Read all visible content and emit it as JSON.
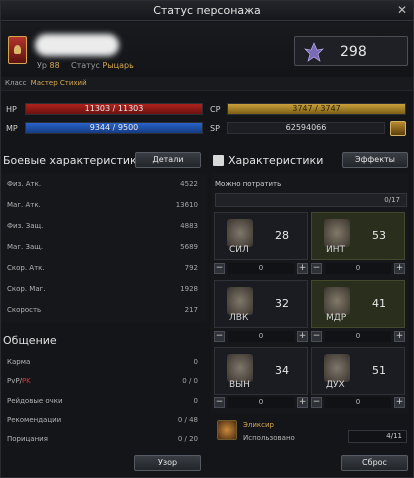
{
  "window": {
    "title": "Статус персонажа"
  },
  "character": {
    "level_label": "Ур",
    "level": "88",
    "status_label": "Статус",
    "status": "Рыцарь",
    "points": "298",
    "class_label": "Класс",
    "class_name": "Мастер Стихий"
  },
  "bars": {
    "hp_label": "HP",
    "hp": "11303 / 11303",
    "mp_label": "MP",
    "mp": "9344 / 9500",
    "cp_label": "CP",
    "cp": "3747 / 3747",
    "sp_label": "SP",
    "sp": "62594066"
  },
  "combat": {
    "title": "Боевые характеристики",
    "details_button": "Детали",
    "rows": [
      {
        "label": "Физ. Атк.",
        "value": "4522"
      },
      {
        "label": "Маг. Атк.",
        "value": "13610"
      },
      {
        "label": "Физ. Защ.",
        "value": "4883"
      },
      {
        "label": "Маг. Защ.",
        "value": "5689"
      },
      {
        "label": "Скор. Атк.",
        "value": "792"
      },
      {
        "label": "Скор. Маг.",
        "value": "1928"
      },
      {
        "label": "Скорость",
        "value": "217"
      }
    ]
  },
  "social": {
    "title": "Общение",
    "rows": [
      {
        "label": "Карма",
        "value": "0"
      },
      {
        "label_pvp": "PvP/",
        "label_pk": "PK",
        "value": "0 / 0"
      },
      {
        "label": "Рейдовые очки",
        "value": "0"
      },
      {
        "label": "Рекомендации",
        "value": "0 / 48"
      },
      {
        "label": "Порицания",
        "value": "0 / 20"
      }
    ]
  },
  "stats": {
    "title": "Характеристики",
    "effects_button": "Эффекты",
    "available_label": "Можно потратить",
    "available": "0/17",
    "items": [
      {
        "abbr": "СИЛ",
        "value": "28",
        "alloc": "0",
        "icon": "strength-icon"
      },
      {
        "abbr": "ИНТ",
        "value": "53",
        "alloc": "0",
        "icon": "intelligence-icon"
      },
      {
        "abbr": "ЛВК",
        "value": "32",
        "alloc": "0",
        "icon": "dexterity-icon"
      },
      {
        "abbr": "МДР",
        "value": "41",
        "alloc": "0",
        "icon": "wisdom-icon"
      },
      {
        "abbr": "ВЫН",
        "value": "34",
        "alloc": "0",
        "icon": "constitution-icon"
      },
      {
        "abbr": "ДУХ",
        "value": "51",
        "alloc": "0",
        "icon": "mentality-icon"
      }
    ]
  },
  "elixir": {
    "title": "Эликсир",
    "used_label": "Использовано",
    "used": "4/11"
  },
  "footer": {
    "view_button": "Узор",
    "reset_button": "Сброс"
  },
  "colors": {
    "accent_gold": "#d6a84c",
    "hp": "#b0221d",
    "mp": "#2a63c9",
    "cp": "#caa03a",
    "pk_red": "#d23a2f"
  }
}
